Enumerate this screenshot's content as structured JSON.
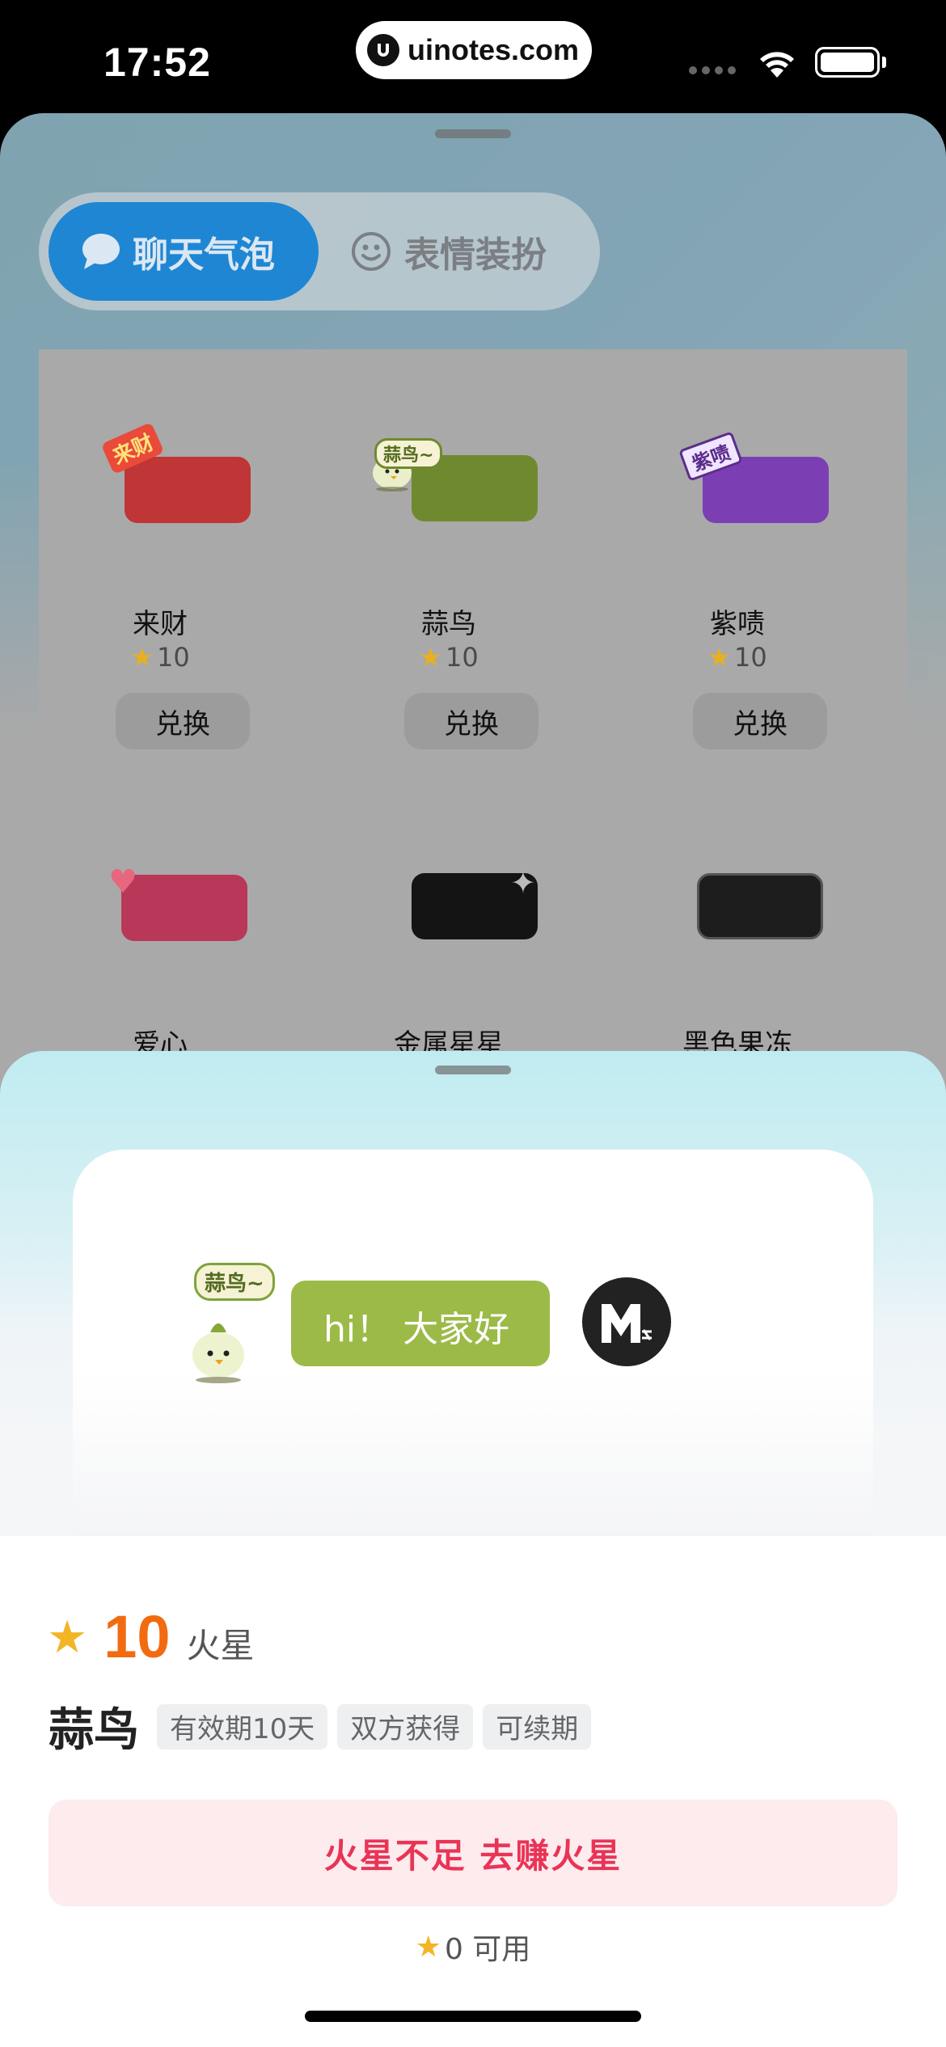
{
  "status_bar": {
    "time": "17:52",
    "url": "uinotes.com"
  },
  "back_sheet": {
    "tabs": [
      {
        "label": "聊天气泡",
        "active": true
      },
      {
        "label": "表情装扮",
        "active": false
      }
    ],
    "items": [
      {
        "name": "来财",
        "price": "10",
        "action": "兑换",
        "color": "#c03535",
        "badge": "来财"
      },
      {
        "name": "蒜鸟",
        "price": "10",
        "action": "兑换",
        "color": "#6f8a2e",
        "badge": "蒜鸟~"
      },
      {
        "name": "紫啧",
        "price": "10",
        "action": "兑换",
        "color": "#7c3fb3",
        "badge": "紫啧"
      },
      {
        "name": "爱心",
        "color": "#b93859"
      },
      {
        "name": "金属星星",
        "color": "#141414"
      },
      {
        "name": "黑色果冻",
        "color": "#1d1d1d"
      }
    ]
  },
  "preview": {
    "badge": "蒜鸟~",
    "message": "hi！ 大家好",
    "bubble_color": "#9cba48"
  },
  "detail": {
    "price": "10",
    "currency": "火星",
    "title": "蒜鸟",
    "tags": [
      "有效期10天",
      "双方获得",
      "可续期"
    ],
    "cta": "火星不足 去赚火星",
    "available": "0 可用"
  }
}
